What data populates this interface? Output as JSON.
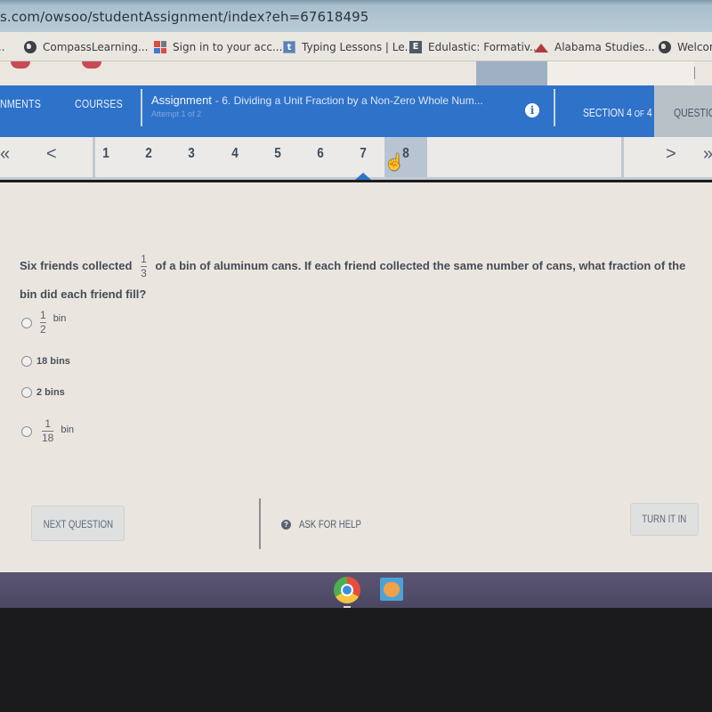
{
  "browser": {
    "url": "s.com/owsoo/studentAssignment/index?eh=67618495",
    "bookmarks": [
      {
        "label": "...",
        "icon": "truncated"
      },
      {
        "label": "CompassLearning...",
        "icon": "globe-icon"
      },
      {
        "label": "Sign in to your acc...",
        "icon": "microsoft-icon"
      },
      {
        "label": "Typing Lessons | Le...",
        "icon": "typing-t-icon"
      },
      {
        "label": "Edulastic: Formativ...",
        "icon": "edulastic-e-icon"
      },
      {
        "label": "Alabama Studies...",
        "icon": "apple-icon"
      },
      {
        "label": "Welcom",
        "icon": "globe-icon"
      }
    ]
  },
  "nav": {
    "items": [
      "NMENTS",
      "COURSES"
    ],
    "assignment_label": "Assignment",
    "assignment_title": "- 6. Dividing a Unit Fraction by a Non-Zero Whole Num...",
    "attempt": "Attempt 1 of 2",
    "info_icon": "i",
    "section_prefix": "SECTION 4",
    "section_of": "OF",
    "section_total": "4",
    "question_label": "QUESTION",
    "accent_color": "#2f72c9"
  },
  "pager": {
    "first": "«",
    "prev": "<",
    "pages": [
      "1",
      "2",
      "3",
      "4",
      "5",
      "6",
      "7",
      "8"
    ],
    "current": "7",
    "hovered": "8",
    "next": ">",
    "last": "»"
  },
  "question": {
    "text_before": "Six friends collected",
    "fraction": {
      "numerator": "1",
      "denominator": "3"
    },
    "text_after": "of a bin of aluminum cans. If each friend collected the same number of cans, what fraction of the bin did each friend fill?",
    "options": [
      {
        "type": "fraction",
        "numerator": "1",
        "denominator": "2",
        "unit": "bin",
        "selected": false
      },
      {
        "type": "text",
        "text": "18 bins",
        "selected": false
      },
      {
        "type": "text",
        "text": "2 bins",
        "selected": false
      },
      {
        "type": "fraction",
        "numerator": "1",
        "denominator": "18",
        "unit": "bin",
        "selected": false
      }
    ]
  },
  "actions": {
    "next_question": "NEXT QUESTION",
    "ask_for_help": "ASK FOR HELP",
    "help_icon": "?",
    "turn_it_in": "TURN IT IN"
  },
  "taskbar": {
    "apps": [
      "chrome-icon",
      "scratch-jr-icon"
    ]
  }
}
